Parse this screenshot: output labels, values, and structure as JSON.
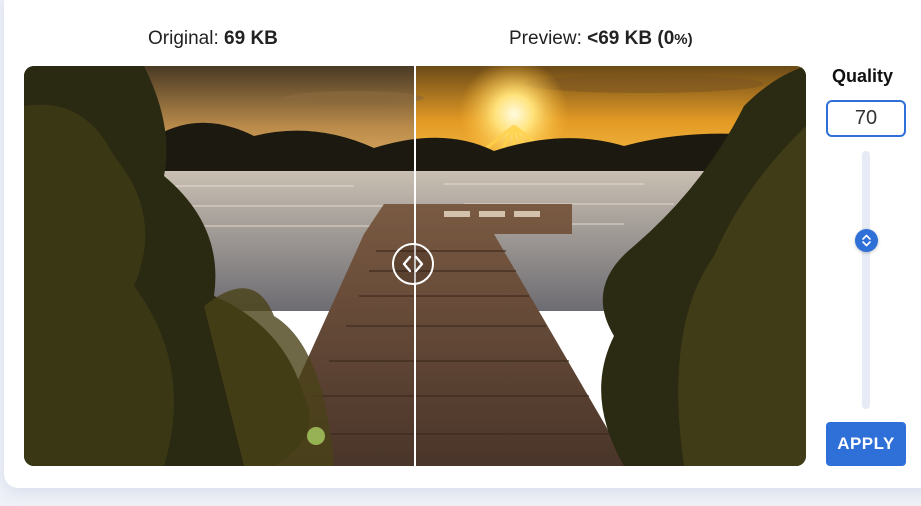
{
  "sizes": {
    "original_label": "Original:",
    "original_value": "69 KB",
    "preview_label": "Preview:",
    "preview_value": "<69 KB (0",
    "preview_pct": "%)"
  },
  "quality": {
    "label": "Quality",
    "value": "70",
    "slider_level": 0.7
  },
  "apply_label": "APPLY",
  "icons": {
    "compare_handle": "chevron-left-right-icon",
    "slider_thumb": "chevron-up-down-icon"
  },
  "colors": {
    "accent": "#2f6fd8"
  }
}
